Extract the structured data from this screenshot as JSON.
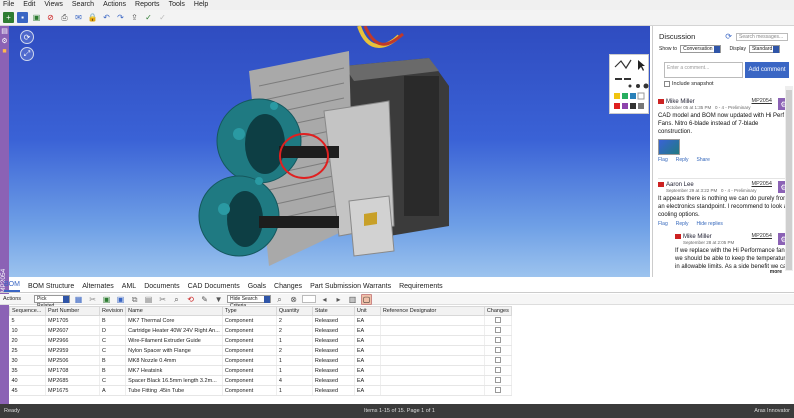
{
  "menu": [
    "File",
    "Edit",
    "Views",
    "Search",
    "Actions",
    "Reports",
    "Tools",
    "Help"
  ],
  "sidebar": {
    "vertical_label": "MP2054"
  },
  "discussion": {
    "title": "Discussion",
    "search_placeholder": "Search messages...",
    "show_to_label": "Show to",
    "show_to_value": "Conversation",
    "display_label": "Display",
    "display_value": "Standard",
    "comment_placeholder": "Enter a comment...",
    "include_snapshot": "Include snapshot",
    "add_comment": "Add comment",
    "more": "more",
    "messages": [
      {
        "author": "Mike Miller",
        "time": "October 05 at 1:35 PM",
        "meta": "0 - 4 - Preliminary",
        "item": "MP2054",
        "body": "CAD model and BOM now updated with Hi Perf Fans. Nitro 6-blade instead of 7-blade construction.",
        "likes": "Like",
        "reply": "Reply",
        "share": "Share",
        "flag": "Flag"
      },
      {
        "author": "Aaron Lee",
        "time": "September 29 at 3:22 PM",
        "meta": "0 - 4 - Preliminary",
        "item": "MP2054",
        "body": "It appears there is nothing we can do purely from an electronics standpoint. I recommend to look at cooling options.",
        "flag": "Flag",
        "likes": "Like",
        "reply": "Reply",
        "hide": "Hide replies"
      },
      {
        "author": "Mike Miller",
        "time": "September 28 at 2:05 PM",
        "meta": "0 - 4 - Preliminary",
        "item": "MP2054",
        "body": "If we replace with the Hi Performance fan, we should be able to keep the temperature in allowable limits. As a side benefit we can"
      }
    ]
  },
  "tabs": [
    "BOM",
    "BOM Structure",
    "Alternates",
    "AML",
    "Documents",
    "CAD Documents",
    "Goals",
    "Changes",
    "Part Submission Warrants",
    "Requirements"
  ],
  "grid_toolbar": {
    "actions": "Actions",
    "pick": "Pick Related",
    "search_mode": "Hide Search Criteria"
  },
  "grid": {
    "columns": [
      "Sequence...",
      "Part Number",
      "Revision",
      "Name",
      "Type",
      "Quantity",
      "State",
      "Unit",
      "Reference Designator",
      "Changes"
    ],
    "rows": [
      [
        "5",
        "MP1705",
        "B",
        "MK7 Thermal Core",
        "Component",
        "2",
        "Released",
        "EA",
        ""
      ],
      [
        "10",
        "MP2607",
        "D",
        "Cartridge Heater 40W 24V Right An...",
        "Component",
        "2",
        "Released",
        "EA",
        ""
      ],
      [
        "20",
        "MP2966",
        "C",
        "Wire-Filament Extruder Guide",
        "Component",
        "1",
        "Released",
        "EA",
        ""
      ],
      [
        "25",
        "MP2959",
        "C",
        "Nylon Spacer with Flange",
        "Component",
        "2",
        "Released",
        "EA",
        ""
      ],
      [
        "30",
        "MP2506",
        "B",
        "MK8 Nozzle 0.4mm",
        "Component",
        "1",
        "Released",
        "EA",
        ""
      ],
      [
        "35",
        "MP1708",
        "B",
        "MK7 Heatsink",
        "Component",
        "1",
        "Released",
        "EA",
        ""
      ],
      [
        "40",
        "MP2685",
        "C",
        "Spacer Black 16.5mm length 3.2m...",
        "Component",
        "4",
        "Released",
        "EA",
        ""
      ],
      [
        "45",
        "MP1675",
        "A",
        "Tube Fitting .45in Tube",
        "Component",
        "1",
        "Released",
        "EA",
        ""
      ]
    ]
  },
  "status": {
    "left": "Ready",
    "middle": "Items 1-15 of 15. Page 1 of 1",
    "right": "Aras Innovator"
  },
  "colors": {
    "accent": "#8b62b5",
    "link": "#3a66c4",
    "viewport": "#3a62d6"
  }
}
